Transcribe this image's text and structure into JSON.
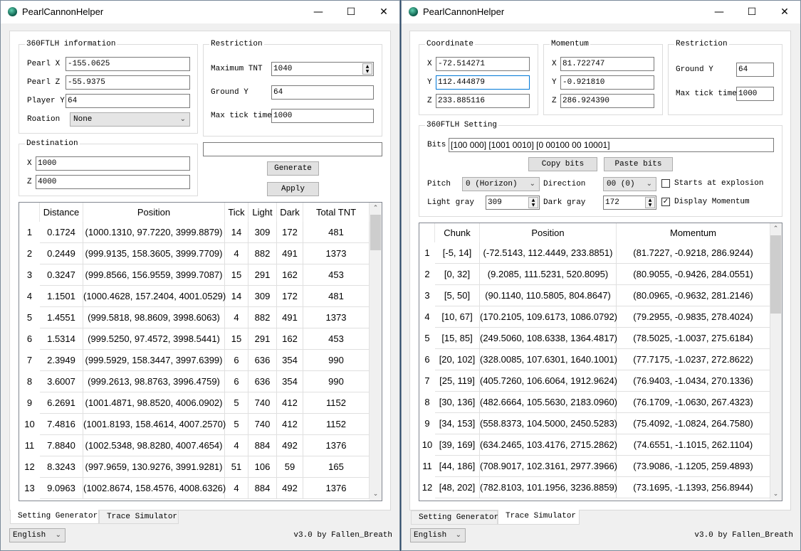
{
  "left": {
    "title": "PearlCannonHelper",
    "info": {
      "title": "360FTLH information",
      "pearl_x_label": "Pearl X",
      "pearl_x": "-155.0625",
      "pearl_z_label": "Pearl Z",
      "pearl_z": "-55.9375",
      "player_y_label": "Player Y",
      "player_y": "64",
      "rotation_label": "Roation",
      "rotation": "None"
    },
    "restriction": {
      "title": "Restriction",
      "max_tnt_label": "Maximum TNT",
      "max_tnt": "1040",
      "ground_y_label": "Ground Y",
      "ground_y": "64",
      "max_tick_label": "Max tick time",
      "max_tick": "1000"
    },
    "destination": {
      "title": "Destination",
      "x_label": "X",
      "x": "1000",
      "z_label": "Z",
      "z": "4000"
    },
    "status_text": "",
    "generate_label": "Generate",
    "apply_label": "Apply",
    "table": {
      "columns": [
        "",
        "Distance",
        "Position",
        "Tick",
        "Light",
        "Dark",
        "Total TNT"
      ],
      "rows": [
        [
          "1",
          "0.1724",
          "(1000.1310, 97.7220, 3999.8879)",
          "14",
          "309",
          "172",
          "481"
        ],
        [
          "2",
          "0.2449",
          "(999.9135, 158.3605, 3999.7709)",
          "4",
          "882",
          "491",
          "1373"
        ],
        [
          "3",
          "0.3247",
          "(999.8566, 156.9559, 3999.7087)",
          "15",
          "291",
          "162",
          "453"
        ],
        [
          "4",
          "1.1501",
          "(1000.4628, 157.2404, 4001.0529)",
          "14",
          "309",
          "172",
          "481"
        ],
        [
          "5",
          "1.4551",
          "(999.5818, 98.8609, 3998.6063)",
          "4",
          "882",
          "491",
          "1373"
        ],
        [
          "6",
          "1.5314",
          "(999.5250, 97.4572, 3998.5441)",
          "15",
          "291",
          "162",
          "453"
        ],
        [
          "7",
          "2.3949",
          "(999.5929, 158.3447, 3997.6399)",
          "6",
          "636",
          "354",
          "990"
        ],
        [
          "8",
          "3.6007",
          "(999.2613, 98.8763, 3996.4759)",
          "6",
          "636",
          "354",
          "990"
        ],
        [
          "9",
          "6.2691",
          "(1001.4871, 98.8520, 4006.0902)",
          "5",
          "740",
          "412",
          "1152"
        ],
        [
          "10",
          "7.4816",
          "(1001.8193, 158.4614, 4007.2570)",
          "5",
          "740",
          "412",
          "1152"
        ],
        [
          "11",
          "7.8840",
          "(1002.5348, 98.8280, 4007.4654)",
          "4",
          "884",
          "492",
          "1376"
        ],
        [
          "12",
          "8.3243",
          "(997.9659, 130.9276, 3991.9281)",
          "51",
          "106",
          "59",
          "165"
        ],
        [
          "13",
          "9.0963",
          "(1002.8674, 158.4576, 4008.6326)",
          "4",
          "884",
          "492",
          "1376"
        ]
      ]
    },
    "tabs": [
      {
        "label": "Setting Generator",
        "selected": true
      },
      {
        "label": "Trace Simulator",
        "selected": false
      }
    ],
    "language": "English",
    "version": "v3.0 by Fallen_Breath"
  },
  "right": {
    "title": "PearlCannonHelper",
    "coordinate": {
      "title": "Coordinate",
      "x_label": "X",
      "x": "-72.514271",
      "y_label": "Y",
      "y": "112.444879",
      "z_label": "Z",
      "z": "233.885116"
    },
    "momentum": {
      "title": "Momentum",
      "x_label": "X",
      "x": "81.722747",
      "y_label": "Y",
      "y": "-0.921810",
      "z_label": "Z",
      "z": "286.924390"
    },
    "restriction": {
      "title": "Restriction",
      "ground_y_label": "Ground Y",
      "ground_y": "64",
      "max_tick_label": "Max tick time",
      "max_tick": "1000"
    },
    "setting": {
      "title": "360FTLH Setting",
      "bits_label": "Bits",
      "bits": "[100 000] [1001 0010] [0 00100 00 10001]",
      "copy_label": "Copy bits",
      "paste_label": "Paste bits",
      "pitch_label": "Pitch",
      "pitch": "0 (Horizon)",
      "direction_label": "Direction",
      "direction": "00 (0)",
      "starts_label": "Starts at explosion",
      "starts_checked": false,
      "light_label": "Light gray",
      "light": "309",
      "dark_label": "Dark gray",
      "dark": "172",
      "display_label": "Display Momentum",
      "display_checked": true
    },
    "table": {
      "columns": [
        "",
        "Chunk",
        "Position",
        "Momentum"
      ],
      "rows": [
        [
          "1",
          "[-5, 14]",
          "(-72.5143, 112.4449, 233.8851)",
          "(81.7227, -0.9218, 286.9244)"
        ],
        [
          "2",
          "[0, 32]",
          "(9.2085, 111.5231, 520.8095)",
          "(80.9055, -0.9426, 284.0551)"
        ],
        [
          "3",
          "[5, 50]",
          "(90.1140, 110.5805, 804.8647)",
          "(80.0965, -0.9632, 281.2146)"
        ],
        [
          "4",
          "[10, 67]",
          "(170.2105, 109.6173, 1086.0792)",
          "(79.2955, -0.9835, 278.4024)"
        ],
        [
          "5",
          "[15, 85]",
          "(249.5060, 108.6338, 1364.4817)",
          "(78.5025, -1.0037, 275.6184)"
        ],
        [
          "6",
          "[20, 102]",
          "(328.0085, 107.6301, 1640.1001)",
          "(77.7175, -1.0237, 272.8622)"
        ],
        [
          "7",
          "[25, 119]",
          "(405.7260, 106.6064, 1912.9624)",
          "(76.9403, -1.0434, 270.1336)"
        ],
        [
          "8",
          "[30, 136]",
          "(482.6664, 105.5630, 2183.0960)",
          "(76.1709, -1.0630, 267.4323)"
        ],
        [
          "9",
          "[34, 153]",
          "(558.8373, 104.5000, 2450.5283)",
          "(75.4092, -1.0824, 264.7580)"
        ],
        [
          "10",
          "[39, 169]",
          "(634.2465, 103.4176, 2715.2862)",
          "(74.6551, -1.1015, 262.1104)"
        ],
        [
          "11",
          "[44, 186]",
          "(708.9017, 102.3161, 2977.3966)",
          "(73.9086, -1.1205, 259.4893)"
        ],
        [
          "12",
          "[48, 202]",
          "(782.8103, 101.1956, 3236.8859)",
          "(73.1695, -1.1393, 256.8944)"
        ]
      ]
    },
    "tabs": [
      {
        "label": "Setting Generator",
        "selected": false
      },
      {
        "label": "Trace Simulator",
        "selected": true
      }
    ],
    "language": "English",
    "version": "v3.0 by Fallen_Breath"
  }
}
